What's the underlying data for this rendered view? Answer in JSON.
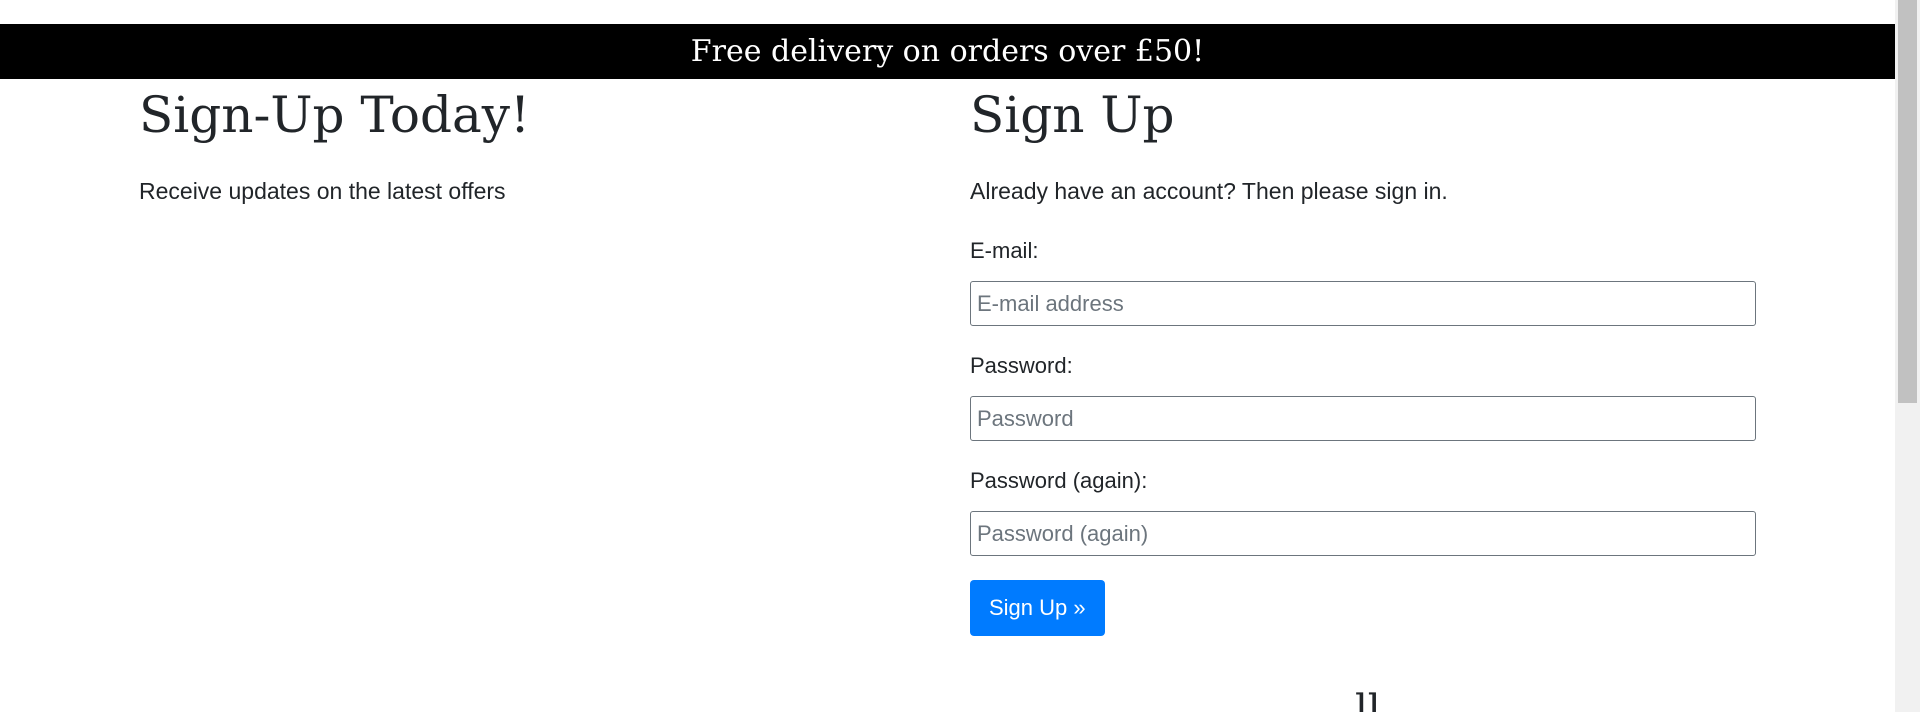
{
  "banner": {
    "text": "Free delivery on orders over £50!"
  },
  "promo": {
    "title": "Sign-Up Today!",
    "subtitle": "Receive updates on the latest offers"
  },
  "signup": {
    "title": "Sign Up",
    "signin_prefix": "Already have an account? Then please ",
    "signin_link": "sign in",
    "signin_suffix": ".",
    "fields": {
      "email": {
        "label": "E-mail:",
        "placeholder": "E-mail address",
        "value": ""
      },
      "password": {
        "label": "Password:",
        "placeholder": "Password",
        "value": ""
      },
      "password_again": {
        "label": "Password (again):",
        "placeholder": "Password (again)",
        "value": ""
      }
    },
    "submit_label": "Sign Up »"
  },
  "colors": {
    "banner_bg": "#000000",
    "banner_text": "#ffffff",
    "primary": "#007bff",
    "text": "#212529"
  }
}
